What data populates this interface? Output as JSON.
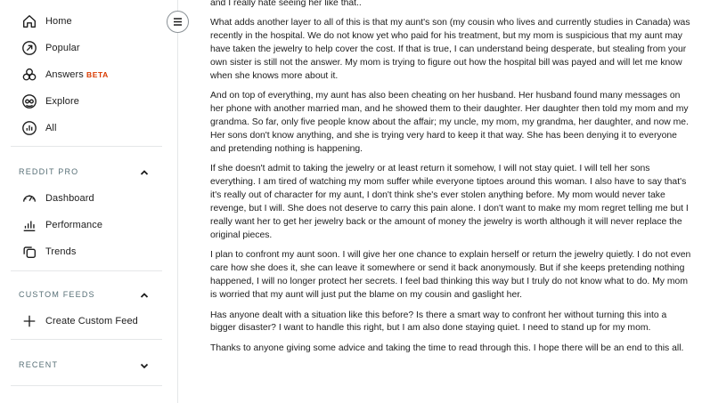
{
  "sidebar": {
    "nav": [
      {
        "label": "Home",
        "icon": "home-icon"
      },
      {
        "label": "Popular",
        "icon": "popular-arrow-icon"
      },
      {
        "label": "Answers",
        "icon": "answers-icon",
        "badge": "BETA"
      },
      {
        "label": "Explore",
        "icon": "explore-icon"
      },
      {
        "label": "All",
        "icon": "all-icon"
      }
    ],
    "reddit_pro": {
      "title": "REDDIT PRO",
      "items": [
        {
          "label": "Dashboard",
          "icon": "dashboard-gauge-icon"
        },
        {
          "label": "Performance",
          "icon": "performance-bars-icon"
        },
        {
          "label": "Trends",
          "icon": "trends-icon"
        }
      ]
    },
    "custom_feeds": {
      "title": "CUSTOM FEEDS",
      "create_label": "Create Custom Feed"
    },
    "recent": {
      "title": "RECENT"
    }
  },
  "post": {
    "paragraphs": [
      "and I really hate seeing her like that..",
      "What adds another layer to all of this is that my aunt's son (my cousin who lives and currently studies in Canada) was recently in the hospital. We do not know yet who paid for his treatment, but my mom is suspicious that my aunt may have taken the jewelry to help cover the cost. If that is true, I can understand being desperate, but stealing from your own sister is still not the answer. My mom is trying to figure out how the hospital bill was payed and will let me know when she knows more about it.",
      "And on top of everything, my aunt has also been cheating on her husband. Her husband found many messages on her phone with another married man, and he showed them to their daughter. Her daughter then told my mom and my grandma. So far, only five people know about the affair; my uncle, my mom, my grandma, her daughter, and now me. Her sons don't know anything, and she is trying very hard to keep it that way. She has been denying it to everyone and pretending nothing is happening.",
      "If she doesn't admit to taking the jewelry or at least return it somehow, I will not stay quiet. I will tell her sons everything. I am tired of watching my mom suffer while everyone tiptoes around this woman. I also have to say that's it's really out of character for my aunt, I don't think she's ever stolen anything before. My mom would never take revenge, but I will. She does not deserve to carry this pain alone. I don't want to make my mom regret telling me but I really want her to get her jewelry back or the amount of money the jewelry is worth although it will never replace the original pieces.",
      "I plan to confront my aunt soon. I will give her one chance to explain herself or return the jewelry quietly. I do not even care how she does it, she can leave it somewhere or send it back anonymously. But if she keeps pretending nothing happened, I will no longer protect her secrets. I feel bad thinking this way but I truly do not know what to do. My mom is worried that my aunt will just put the blame on my cousin and gaslight her.",
      "Has anyone dealt with a situation like this before? Is there a smart way to confront her without turning this into a bigger disaster? I want to handle this right, but I am also done staying quiet. I need to stand up for my mom.",
      "Thanks to anyone giving some advice and taking the time to read through this. I hope there will be an end to this all."
    ]
  },
  "colors": {
    "beta_badge": "#d93a00",
    "section_title": "#576f76",
    "divider": "#e5e7e8",
    "text": "#1c1c1c"
  }
}
